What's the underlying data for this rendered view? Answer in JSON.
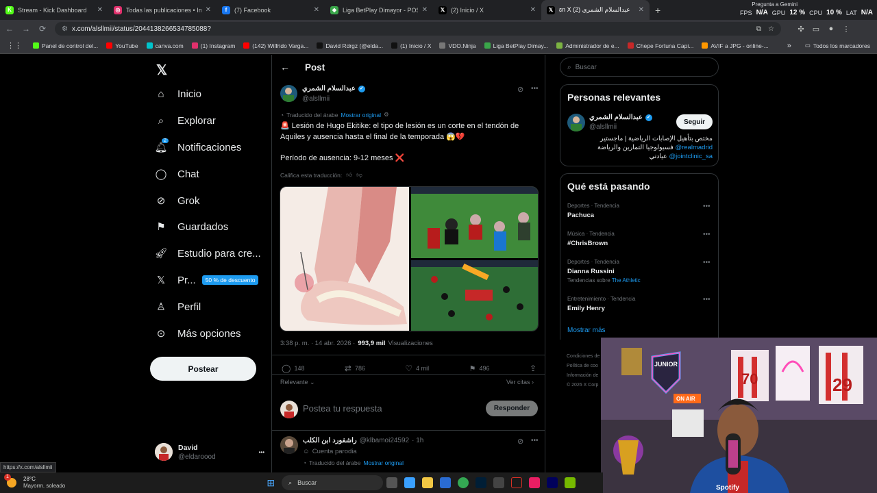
{
  "browser": {
    "tabs": [
      {
        "title": "Stream - Kick Dashboard",
        "favicon": "kick-icon",
        "color": "#53fc18",
        "glyph": "K"
      },
      {
        "title": "Todas las publicaciones • Instagram",
        "favicon": "instagram-icon",
        "color": "#e1306c",
        "glyph": "◎"
      },
      {
        "title": "(7) Facebook",
        "favicon": "facebook-icon",
        "color": "#1877f2",
        "glyph": "f"
      },
      {
        "title": "Liga BetPlay Dimayor - POSICIONES",
        "favicon": "liga-icon",
        "color": "#3aa64a",
        "glyph": "◆"
      },
      {
        "title": "(2) Inicio / X",
        "favicon": "x-icon",
        "color": "#000000",
        "glyph": "𝕏"
      },
      {
        "title": "ɛn X (2) عبدالسلام الشمري",
        "favicon": "x-icon",
        "color": "#000000",
        "glyph": "𝕏",
        "active": true
      }
    ],
    "new_tab": "+",
    "perf": {
      "gemini": "Pregunta a Gemini",
      "fps_label": "FPS",
      "fps": "N/A",
      "gpu_label": "GPU",
      "gpu": "12 %",
      "cpu_label": "CPU",
      "cpu": "10 %",
      "lat_label": "LAT",
      "lat": "N/A"
    },
    "url": "x.com/alsllmii/status/2044138266534785088?",
    "bookmarks": [
      {
        "label": "Panel de control del...",
        "color": "#53fc18"
      },
      {
        "label": "YouTube",
        "color": "#ff0000"
      },
      {
        "label": "canva.com",
        "color": "#00c4cc"
      },
      {
        "label": "(1) Instagram",
        "color": "#e1306c"
      },
      {
        "label": "(142) Wilfrido Varga...",
        "color": "#ff0000"
      },
      {
        "label": "David Rdrgz (@elda...",
        "color": "#111111"
      },
      {
        "label": "(1) Inicio / X",
        "color": "#111111"
      },
      {
        "label": "VDO.Ninja",
        "color": "#777777"
      },
      {
        "label": "Liga BetPlay Dimay...",
        "color": "#3aa64a"
      },
      {
        "label": "Administrador de e...",
        "color": "#7cb342"
      },
      {
        "label": "Chepe Fortuna Capi...",
        "color": "#c62828"
      },
      {
        "label": "AVIF a JPG - online-...",
        "color": "#ff9800"
      }
    ],
    "bookmarks_more": "»",
    "all_bookmarks": "Todos los marcadores",
    "status_url": "https://x.com/alsllmii"
  },
  "sidebar": {
    "items": [
      {
        "label": "Inicio",
        "icon": "home-icon"
      },
      {
        "label": "Explorar",
        "icon": "search-icon"
      },
      {
        "label": "Notificaciones",
        "icon": "bell-icon",
        "badge": "2"
      },
      {
        "label": "Chat",
        "icon": "chat-icon"
      },
      {
        "label": "Grok",
        "icon": "grok-icon"
      },
      {
        "label": "Guardados",
        "icon": "bookmark-icon"
      },
      {
        "label": "Estudio para cre...",
        "icon": "rocket-icon"
      },
      {
        "label": "Pr...",
        "icon": "x-icon",
        "promo": "50 % de descuento"
      },
      {
        "label": "Perfil",
        "icon": "person-icon"
      },
      {
        "label": "Más opciones",
        "icon": "more-circle-icon"
      }
    ],
    "post_button": "Postear",
    "user": {
      "name": "David",
      "handle": "@eldaroood",
      "more": "•••"
    }
  },
  "post": {
    "header": "Post",
    "author_name": "عبدالسلام الشمري",
    "author_handle": "@alsllmii",
    "translated_from": "Traducido del árabe",
    "show_original": "Mostrar original",
    "text_line1": "🚨 Lesión de Hugo Ekitike: el tipo de lesión es un corte en el tendón de Aquiles y ausencia hasta el final de la temporada 😱💔",
    "text_line2": "Período de ausencia: 9-12 meses ❌",
    "rate_translation": "Califica esta traducción:",
    "timestamp": "3:38 p. m. · 14 abr. 2026 ·",
    "views_count": "993,9 mil",
    "views_label": "Visualizaciones",
    "stats": {
      "replies": "148",
      "reposts": "786",
      "likes": "4 mil",
      "bookmarks": "496"
    },
    "sort_label": "Relevante",
    "quotes_label": "Ver citas",
    "reply_placeholder": "Postea tu respuesta",
    "reply_button": "Responder",
    "reply": {
      "name": "راشفورد ابن الكلب",
      "handle": "@klbamoi24592",
      "time": "· 1h",
      "parody": "Cuenta parodia",
      "translated_from": "Traducido del árabe",
      "show_original": "Mostrar original"
    }
  },
  "right": {
    "search_placeholder": "Buscar",
    "relevant_title": "Personas relevantes",
    "relevant_user": {
      "name": "عبدالسلام الشمري",
      "handle": "@alsllmii",
      "follow": "Seguir",
      "bio_line1": "مختص بتأهيل الإصابات الرياضية | ماجستير",
      "bio_line2a": "فسيولوجيا التمارين والرياضة",
      "bio_line2b": "@realmadrid",
      "bio_line3a": "عيادتي",
      "bio_line3b": "@jointclinic_sa"
    },
    "trending_title": "Qué está pasando",
    "trends": [
      {
        "context": "Deportes · Tendencia",
        "name": "Pachuca"
      },
      {
        "context": "Música · Tendencia",
        "name": "#ChrisBrown"
      },
      {
        "context": "Deportes · Tendencia",
        "name": "Dianna Russini",
        "extra_prefix": "Tendencias sobre",
        "extra_link": "The Athletic"
      },
      {
        "context": "Entretenimiento · Tendencia",
        "name": "Emily Henry"
      }
    ],
    "show_more": "Mostrar más",
    "footer": [
      "Condiciones de",
      "Política de coo",
      "Información de",
      "© 2026 X Corp"
    ]
  },
  "webcam": {
    "shirt_numbers": [
      "70",
      "29"
    ],
    "sign1": "JUNIOR",
    "sign2": "ON AIR",
    "shirt_brand": "Spotify"
  },
  "taskbar": {
    "temp": "28°C",
    "weather": "Mayorm. soleado",
    "search": "Buscar",
    "alert": "1"
  }
}
